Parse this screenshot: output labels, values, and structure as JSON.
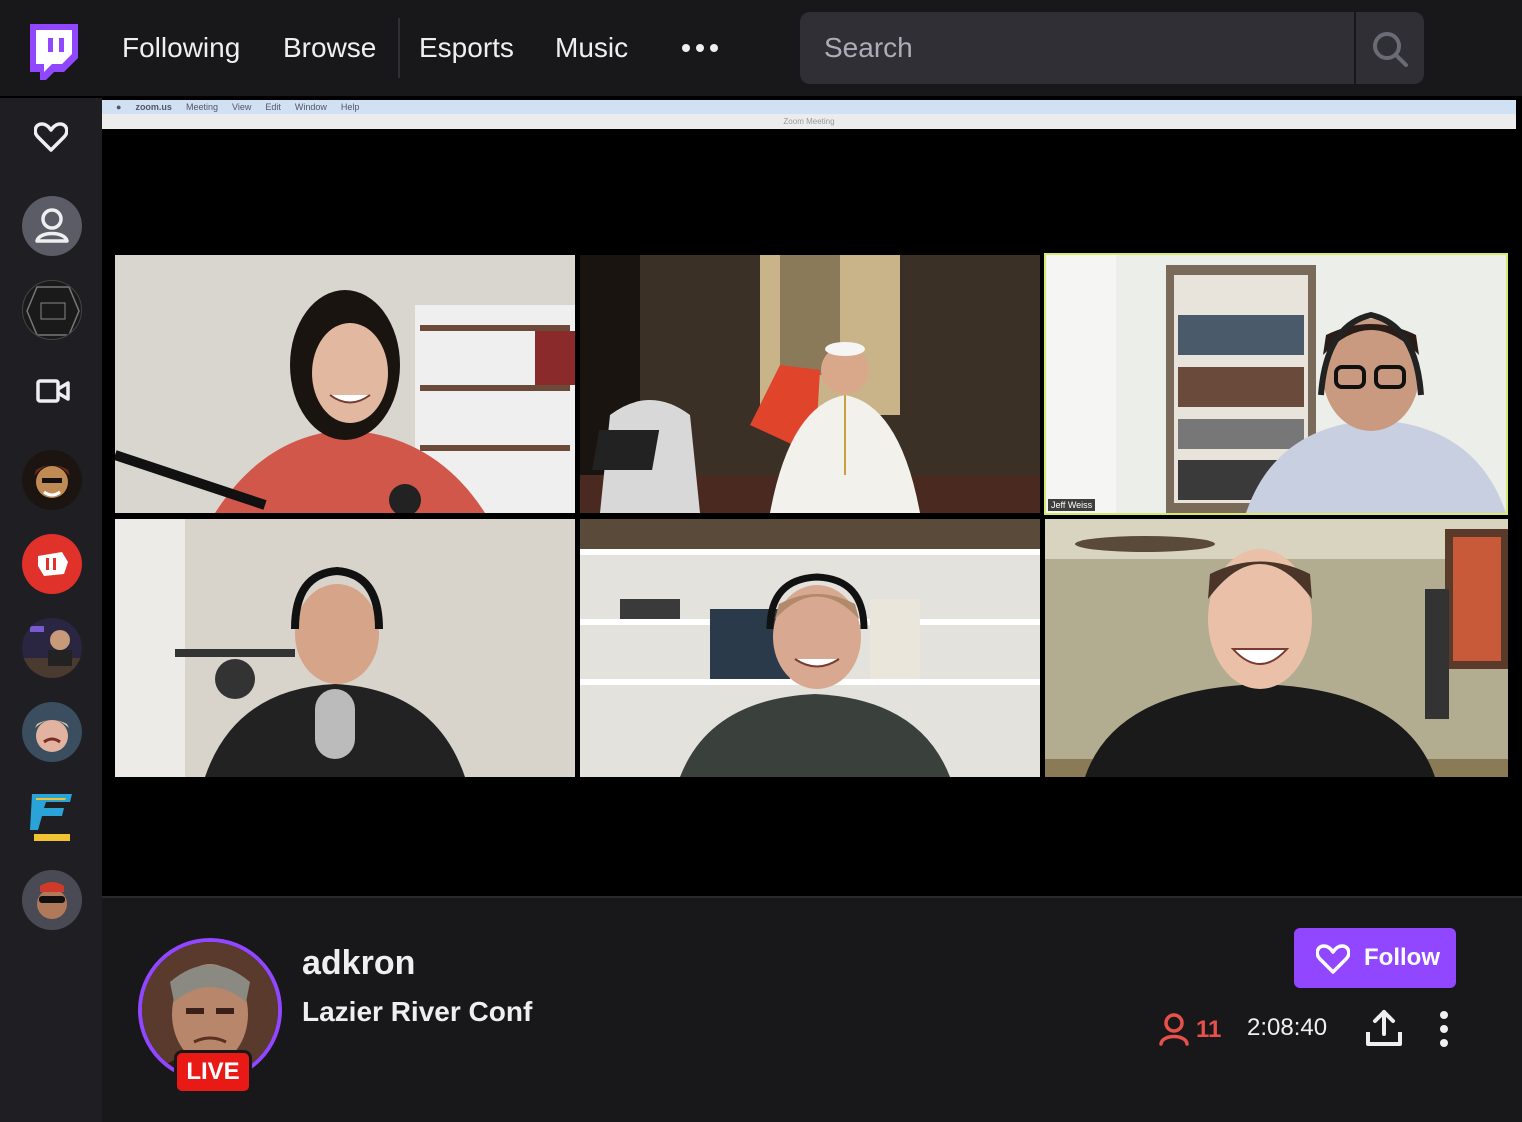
{
  "nav": {
    "links": [
      "Following",
      "Browse",
      "Esports",
      "Music"
    ],
    "more_icon": "more-dots-icon",
    "search_placeholder": "Search"
  },
  "colors": {
    "brand": "#9147ff",
    "live": "#e91916",
    "viewers": "#e8514b",
    "background": "#0e0e10",
    "panel": "#18181b"
  },
  "sidebar": {
    "icons": [
      "heart-icon",
      "user-icon",
      "channel-avatar",
      "video-camera-icon",
      "channel-avatar",
      "channel-avatar",
      "channel-avatar",
      "channel-avatar",
      "channel-avatar",
      "channel-avatar"
    ]
  },
  "video": {
    "zoom_menu": [
      "zoom.us",
      "Meeting",
      "View",
      "Edit",
      "Window",
      "Help"
    ],
    "zoom_window_title": "Zoom Meeting",
    "participant_label": "Jeff Weiss"
  },
  "channel": {
    "name": "adkron",
    "title": "Lazier River Conf",
    "live_label": "LIVE",
    "follow_label": "Follow",
    "viewer_count": "11",
    "uptime": "2:08:40"
  }
}
